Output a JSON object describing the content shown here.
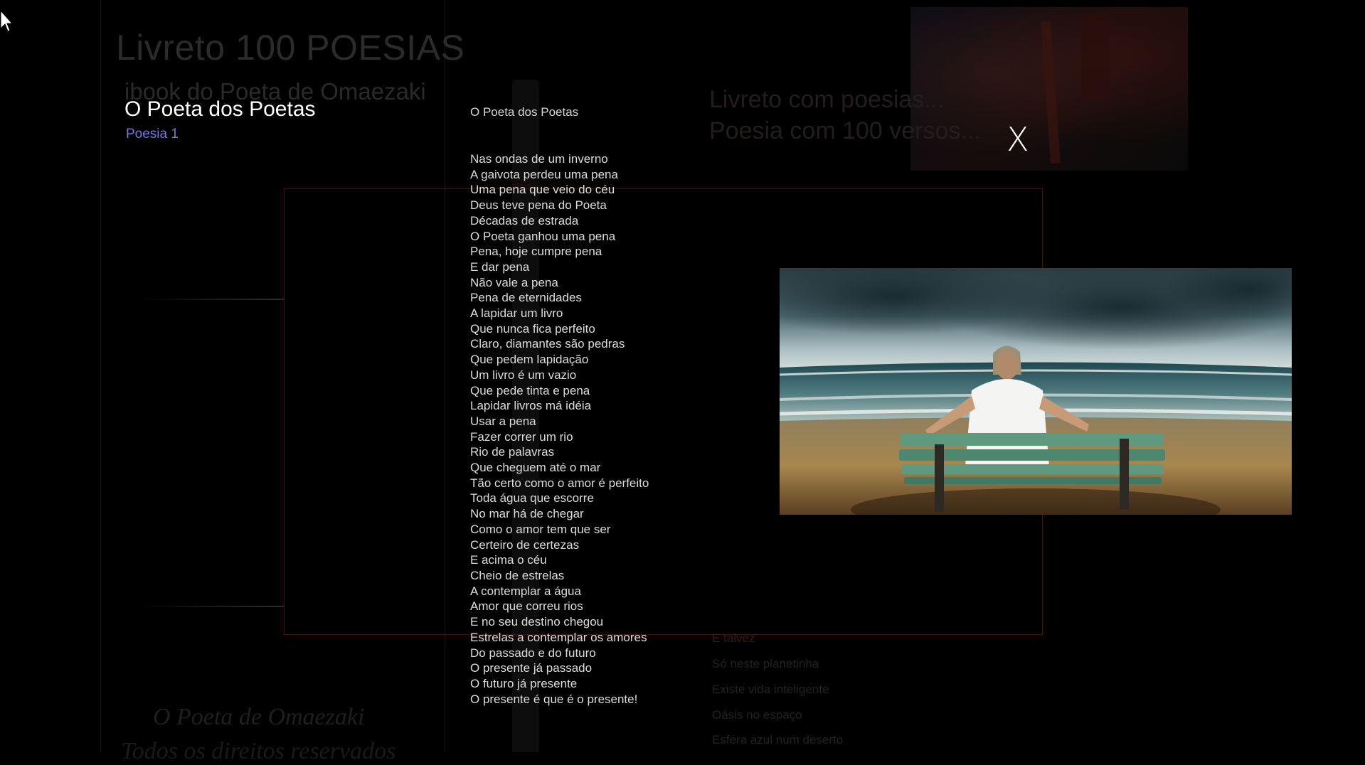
{
  "background": {
    "title": "Livreto 100 POESIAS",
    "subtitle": "ibook do Poeta de Omaezaki",
    "right_title_line1": "Livreto com poesias...",
    "right_title_line2": "Poesia com 100 versos...",
    "signature_line1": "O Poeta de Omaezaki",
    "signature_line2": "Todos os direitos reservados",
    "poem_lines": [
      "E talvez",
      "Só neste planetinha",
      "Existe vida inteligente",
      "Oásis no espaço",
      "Esfera azul num deserto"
    ]
  },
  "lightbox": {
    "title": "O Poeta dos Poetas",
    "subtitle_link": "Poesia 1",
    "close_label": "X",
    "poem_title": "O Poeta dos Poetas",
    "poem_lines": [
      "Nas ondas de um inverno",
      "A gaivota perdeu uma pena",
      "Uma pena que veio do céu",
      "Deus teve pena do Poeta",
      "Décadas de estrada",
      "O Poeta ganhou uma pena",
      "Pena, hoje cumpre pena",
      "E dar pena",
      "Não vale a pena",
      "Pena de eternidades",
      "A lapidar um livro",
      "Que nunca fica perfeito",
      "Claro, diamantes são pedras",
      "Que pedem lapidação",
      "Um livro é um vazio",
      "Que pede tinta e pena",
      "Lapidar livros má idéia",
      "Usar a pena",
      "Fazer correr um rio",
      "Rio de palavras",
      "Que cheguem até o mar",
      "Tão certo como o amor é perfeito",
      "Toda água que escorre",
      "No mar há de chegar",
      "Como o amor tem que ser",
      "Certeiro de certezas",
      "E acima o céu",
      "Cheio de estrelas",
      "A contemplar a água",
      "Amor que correu rios",
      "E no seu destino chegou",
      "Estrelas a contemplar os amores",
      "Do passado e do futuro",
      "O presente já passado",
      "O futuro já presente",
      "O presente é que é o presente!"
    ]
  }
}
